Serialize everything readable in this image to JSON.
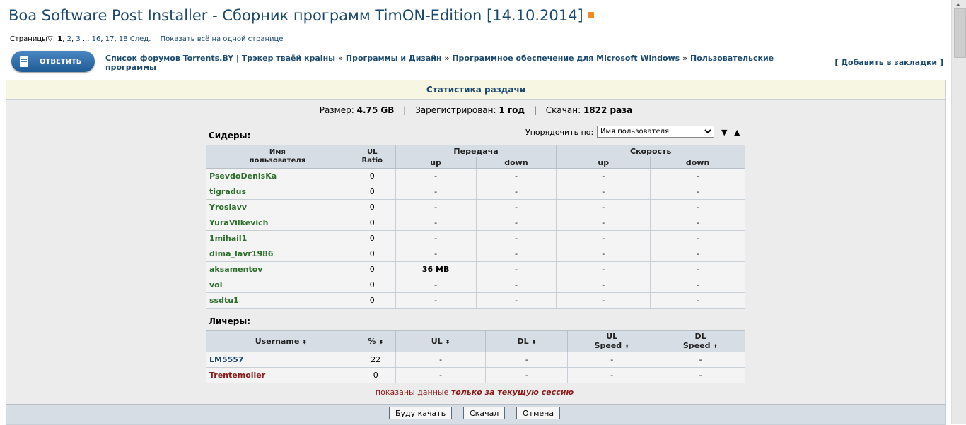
{
  "header": {
    "title": "Boa Software Post Installer - Сборник программ TimON-Edition [14.10.2014]",
    "pages_label": "Страницы",
    "pages_colon": ":",
    "pages": [
      "1",
      "2",
      "3",
      "...",
      "16",
      "17",
      "18"
    ],
    "next": "След.",
    "show_all": "Показать всё на одной странице"
  },
  "reply_button": "ОТВЕТИТЬ",
  "breadcrumb": {
    "items": [
      "Список форумов Torrents.BY | Трэкер тваёй краіны",
      "Программы и Дизайн",
      "Программное обеспечение для Microsoft Windows",
      "Пользовательские программы"
    ],
    "separator": "»"
  },
  "bookmark": "[ Добавить в закладки ]",
  "stats": {
    "title": "Статистика раздачи",
    "size_label": "Размер:",
    "size": "4.75 GB",
    "registered_label": "Зарегистрирован:",
    "registered": "1 год",
    "downloaded_label": "Скачан:",
    "downloaded": "1822 раза",
    "separator": "|"
  },
  "seeders": {
    "label": "Сидеры:",
    "sort_label": "Упорядочить по:",
    "sort_value": "Имя пользователя",
    "sort_desc": "▼",
    "sort_asc": "▲",
    "headers": {
      "name": "Имя пользователя",
      "ratio": "UL Ratio",
      "transfer": "Передача",
      "speed": "Скорость",
      "up": "up",
      "down": "down"
    },
    "rows": [
      {
        "name": "PsevdoDenisKa",
        "ratio": "0",
        "tup": "-",
        "tdown": "-",
        "sup": "-",
        "sdown": "-"
      },
      {
        "name": "tigradus",
        "ratio": "0",
        "tup": "-",
        "tdown": "-",
        "sup": "-",
        "sdown": "-"
      },
      {
        "name": "Yroslavv",
        "ratio": "0",
        "tup": "-",
        "tdown": "-",
        "sup": "-",
        "sdown": "-"
      },
      {
        "name": "YuraVilkevich",
        "ratio": "0",
        "tup": "-",
        "tdown": "-",
        "sup": "-",
        "sdown": "-"
      },
      {
        "name": "1mihail1",
        "ratio": "0",
        "tup": "-",
        "tdown": "-",
        "sup": "-",
        "sdown": "-"
      },
      {
        "name": "dima_lavr1986",
        "ratio": "0",
        "tup": "-",
        "tdown": "-",
        "sup": "-",
        "sdown": "-"
      },
      {
        "name": "aksamentov",
        "ratio": "0",
        "tup": "36 MB",
        "tdown": "-",
        "sup": "-",
        "sdown": "-"
      },
      {
        "name": "vol",
        "ratio": "0",
        "tup": "-",
        "tdown": "-",
        "sup": "-",
        "sdown": "-"
      },
      {
        "name": "ssdtu1",
        "ratio": "0",
        "tup": "-",
        "tdown": "-",
        "sup": "-",
        "sdown": "-"
      }
    ]
  },
  "leechers": {
    "label": "Личеры:",
    "headers": {
      "username": "Username",
      "percent": "%",
      "ul": "UL",
      "dl": "DL",
      "ul_speed_1": "UL",
      "ul_speed_2": "Speed",
      "dl_speed_1": "DL",
      "dl_speed_2": "Speed"
    },
    "sort_icon": "⬍",
    "rows": [
      {
        "name": "LM5557",
        "percent": "22",
        "ul": "-",
        "dl": "-",
        "uls": "-",
        "dls": "-"
      },
      {
        "name": "Trentemoller",
        "percent": "0",
        "ul": "-",
        "dl": "-",
        "uls": "-",
        "dls": "-"
      }
    ]
  },
  "session_note": {
    "prefix": "показаны данные",
    "emph": "только за текущую сессию"
  },
  "buttons": {
    "download": "Буду качать",
    "skip": "Скачал",
    "cancel": "Отмена"
  },
  "colors": {
    "title": "#1c4a6e",
    "seeder_name": "#2d6e2d",
    "leecher_red": "#8b1a1a",
    "header_bg": "#d7dde4",
    "panel_head": "#f6f6e2"
  }
}
